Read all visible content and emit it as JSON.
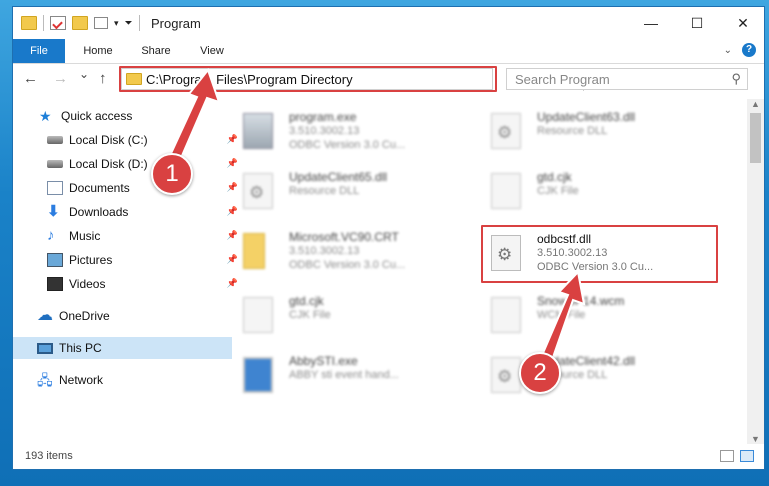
{
  "window": {
    "title": "Program",
    "controls": {
      "minimize": "—",
      "maximize": "☐",
      "close": "✕"
    }
  },
  "ribbon": {
    "tabs": [
      "File",
      "Home",
      "Share",
      "View"
    ]
  },
  "nav": {
    "back": "←",
    "forward": "→",
    "recent": "⌄",
    "up": "↑",
    "address": "C:\\Program Files\\Program Directory",
    "search_placeholder": "Search Program"
  },
  "sidebar": {
    "items": [
      {
        "label": "Quick access",
        "icon": "star-icon"
      },
      {
        "label": "Local Disk (C:)",
        "icon": "disk-icon",
        "pinned": true
      },
      {
        "label": "Local Disk (D:)",
        "icon": "disk-icon",
        "pinned": true
      },
      {
        "label": "Documents",
        "icon": "documents-icon",
        "pinned": true
      },
      {
        "label": "Downloads",
        "icon": "downloads-icon",
        "pinned": true
      },
      {
        "label": "Music",
        "icon": "music-icon",
        "pinned": true
      },
      {
        "label": "Pictures",
        "icon": "pictures-icon",
        "pinned": true
      },
      {
        "label": "Videos",
        "icon": "videos-icon",
        "pinned": true
      },
      {
        "label": "OneDrive",
        "icon": "onedrive-icon"
      },
      {
        "label": "This PC",
        "icon": "computer-icon",
        "selected": true
      },
      {
        "label": "Network",
        "icon": "network-icon"
      }
    ]
  },
  "files": [
    {
      "name": "program.exe",
      "line1": "3.510.3002.13",
      "line2": "ODBC Version 3.0 Cu..."
    },
    {
      "name": "UpdateClient63.dll",
      "line1": "Resource DLL",
      "line2": ""
    },
    {
      "name": "UpdateClient65.dll",
      "line1": "Resource DLL",
      "line2": ""
    },
    {
      "name": "gtd.cjk",
      "line1": "CJK File",
      "line2": ""
    },
    {
      "name": "Microsoft.VC90.CRT",
      "line1": "3.510.3002.13",
      "line2": "ODBC Version 3.0 Cu..."
    },
    {
      "name": "odbcstf.dll",
      "line1": "3.510.3002.13",
      "line2": "ODBC Version 3.0 Cu..."
    },
    {
      "name": "gtd.cjk",
      "line1": "CJK File",
      "line2": ""
    },
    {
      "name": "SnowSP14.wcm",
      "line1": "WCM File",
      "line2": ""
    },
    {
      "name": "AbbySTI.exe",
      "line1": "ABBY sti event hand...",
      "line2": ""
    },
    {
      "name": "UpdateClient42.dll",
      "line1": "Resource DLL",
      "line2": ""
    }
  ],
  "status": {
    "items": "193 items"
  },
  "annotations": {
    "step1": "1",
    "step2": "2",
    "color": "#d94141"
  }
}
